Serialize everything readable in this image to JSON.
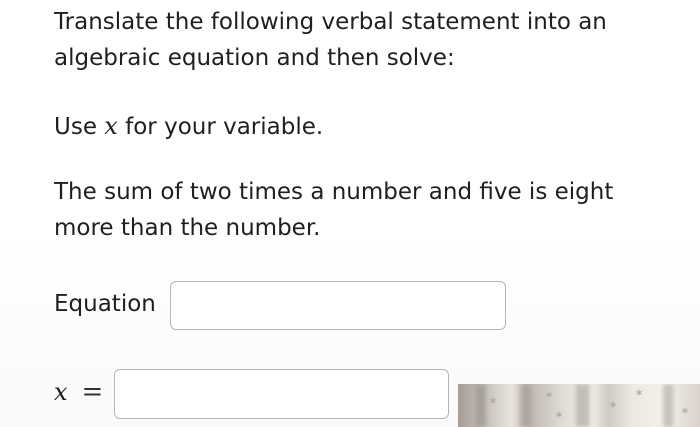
{
  "prompt": {
    "line1": "Translate the following verbal statement into an",
    "line2": "algebraic equation and then solve:"
  },
  "variable_instruction": {
    "prefix": "Use",
    "variable": "x",
    "suffix": "for your variable."
  },
  "statement": {
    "line1": "The sum of two times a number and five is eight",
    "line2": "more than the number."
  },
  "equation_field": {
    "label": "Equation",
    "value": ""
  },
  "answer_field": {
    "variable": "x",
    "equals": "=",
    "value": ""
  }
}
